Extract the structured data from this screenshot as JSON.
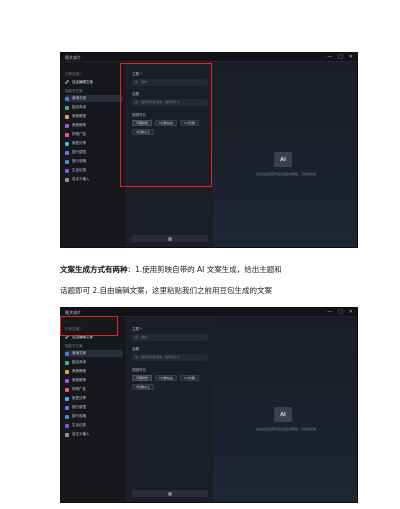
{
  "app": {
    "title": "图文成片",
    "window_controls": [
      "—",
      "□",
      "✕"
    ],
    "sidebar": {
      "top_label": "已有文案？",
      "edit_label": "自由编辑文案",
      "section_label": "智能写文案",
      "items": [
        {
          "label": "营销文案",
          "color": "#4a78e0"
        },
        {
          "label": "励志鸡汤",
          "color": "#3bb58c"
        },
        {
          "label": "美食教程",
          "color": "#e0a23b"
        },
        {
          "label": "美食推荐",
          "color": "#9b5ae0"
        },
        {
          "label": "好物广告",
          "color": "#e05a8a"
        },
        {
          "label": "家居分享",
          "color": "#4ab0e0"
        },
        {
          "label": "旅行感悟",
          "color": "#5a7ae0"
        },
        {
          "label": "旅行攻略",
          "color": "#3b8ee0"
        },
        {
          "label": "生活记录",
          "color": "#7a5ae0"
        },
        {
          "label": "自定义输入",
          "color": "#8a8f9a"
        }
      ]
    },
    "form": {
      "topic_label": "主题 *",
      "topic_placeholder": "如：猫咪",
      "words_label": "话题",
      "words_placeholder": "如：猫咪的身体语言，猫咪吃什么",
      "length_label": "视频时长",
      "durations": [
        "不限时长",
        "1分钟左右",
        "1-3分钟",
        "3分钟以上"
      ]
    },
    "preview": {
      "icon_text": "AI",
      "hint": "在左边设置完毕后点击生成按钮，可生成文案"
    }
  },
  "captions": {
    "line1_bold": "文案生成方式有两种",
    "line1_rest": "：1.使用剪映自带的 AI 文案生成，给出主题和",
    "line2": "话题即可 2.自由编辑文案，这里粘贴我们之前用豆包生成的文案"
  }
}
